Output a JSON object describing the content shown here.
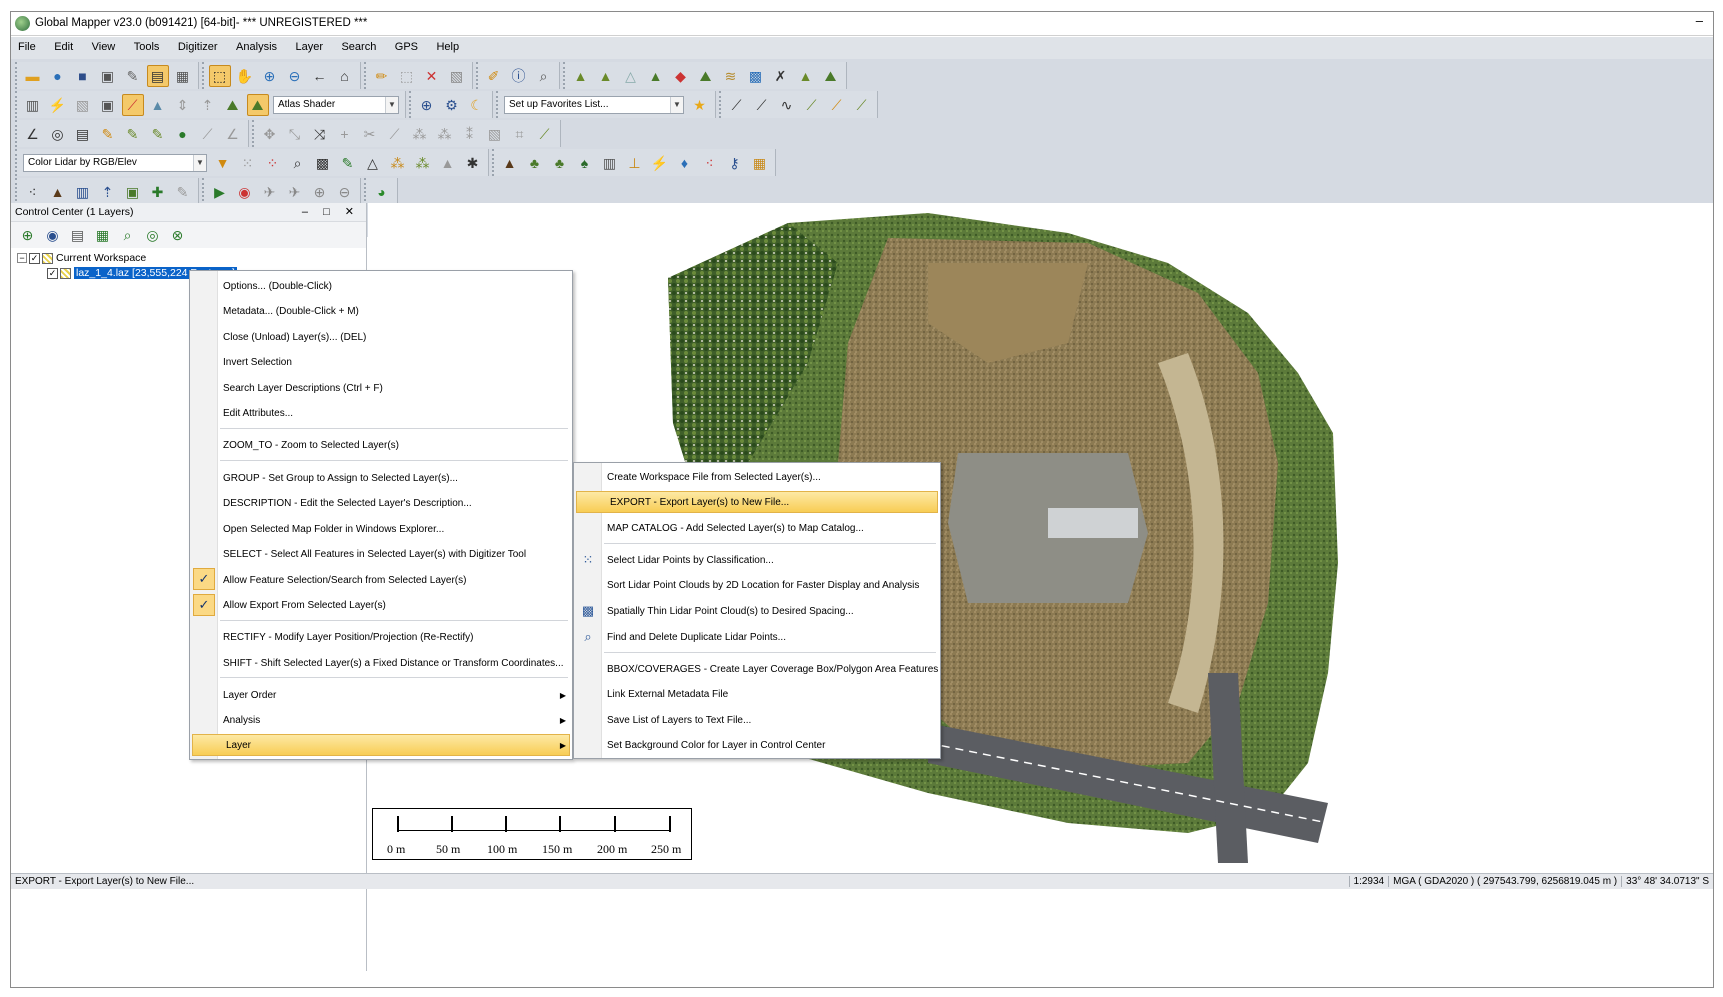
{
  "window": {
    "title": "Global Mapper v23.0 (b091421) [64-bit]- *** UNREGISTERED ***",
    "minimize_glyph": "–"
  },
  "menubar": [
    "File",
    "Edit",
    "View",
    "Tools",
    "Digitizer",
    "Analysis",
    "Layer",
    "Search",
    "GPS",
    "Help"
  ],
  "toolbar": {
    "shader_select": "Atlas Shader",
    "favorites_select": "Set up Favorites List...",
    "lidar_color_select": "Color Lidar by RGB/Elev"
  },
  "control_center": {
    "title": "Control Center (1 Layers)",
    "window_controls": "– □ ✕",
    "workspace_label": "Current Workspace",
    "layer_label": "laz_1_4.laz [23,555,224 Features]"
  },
  "context_menu": {
    "items": [
      "Options... (Double-Click)",
      "Metadata... (Double-Click + M)",
      "Close (Unload) Layer(s)... (DEL)",
      "Invert Selection",
      "Search Layer Descriptions (Ctrl + F)",
      "Edit Attributes...",
      "ZOOM_TO - Zoom to Selected Layer(s)",
      "GROUP - Set Group to Assign to Selected Layer(s)...",
      "DESCRIPTION - Edit the Selected Layer's Description...",
      "Open Selected Map Folder in Windows Explorer...",
      "SELECT - Select All Features in Selected Layer(s) with Digitizer Tool",
      "Allow Feature Selection/Search from Selected Layer(s)",
      "Allow Export From Selected Layer(s)",
      "RECTIFY - Modify Layer Position/Projection (Re-Rectify)",
      "SHIFT - Shift Selected Layer(s) a Fixed Distance or Transform Coordinates...",
      "Layer Order",
      "Analysis",
      "Layer"
    ],
    "checkmark": "✓",
    "submenu_arrow": "▶"
  },
  "submenu": {
    "items": [
      "Create Workspace File from Selected Layer(s)...",
      "EXPORT - Export Layer(s) to New File...",
      "MAP CATALOG - Add Selected Layer(s) to Map Catalog...",
      "Select Lidar Points by Classification...",
      "Sort Lidar Point Clouds by 2D Location for Faster Display and Analysis",
      "Spatially Thin Lidar Point Cloud(s) to Desired Spacing...",
      "Find and Delete Duplicate Lidar Points...",
      "BBOX/COVERAGES  - Create Layer Coverage Box/Polygon Area Features",
      "Link External Metadata File",
      "Save List of Layers to Text File...",
      "Set Background Color for Layer in Control Center"
    ]
  },
  "scalebar": {
    "labels": [
      "0 m",
      "50 m",
      "100 m",
      "150 m",
      "200 m",
      "250 m"
    ]
  },
  "statusbar": {
    "message": "EXPORT - Export Layer(s) to New File...",
    "scale": "1:2934",
    "projection": "MGA ( GDA2020 ) ( 297543.799, 6256819.045 m )",
    "latlon": "33° 48' 34.0713\" S"
  }
}
